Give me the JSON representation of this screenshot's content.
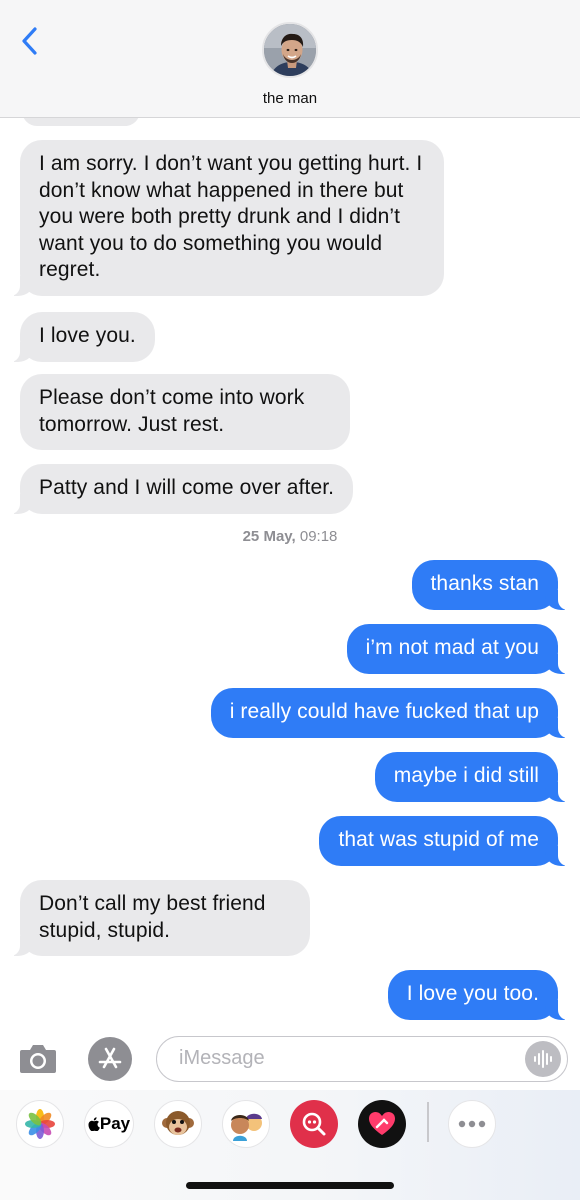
{
  "header": {
    "contact_name": "the man",
    "back_icon": "chevron-left-icon",
    "accent_color": "#2f7cf6"
  },
  "messages": [
    {
      "direction": "incoming",
      "text": "I am sorry. I don’t want you getting hurt. I don’t know what happened in there but you were both pretty drunk and I didn’t want you to do something you would regret."
    },
    {
      "direction": "incoming",
      "text": "I love you."
    },
    {
      "direction": "incoming",
      "text": "Please don’t come into work tomorrow. Just rest."
    },
    {
      "direction": "incoming",
      "text": "Patty and I will come over after."
    },
    {
      "direction": "outgoing",
      "text": "thanks stan"
    },
    {
      "direction": "outgoing",
      "text": "i’m not mad at you"
    },
    {
      "direction": "outgoing",
      "text": "i really could have fucked that up"
    },
    {
      "direction": "outgoing",
      "text": "maybe i did still"
    },
    {
      "direction": "outgoing",
      "text": "that was stupid of me"
    },
    {
      "direction": "incoming",
      "text": "Don’t call my best friend stupid, stupid."
    },
    {
      "direction": "outgoing",
      "text": "I love you too."
    }
  ],
  "timestamp": {
    "date": "25 May,",
    "time": "09:18"
  },
  "input": {
    "placeholder": "iMessage",
    "value": ""
  },
  "app_drawer": {
    "items": [
      {
        "name": "photos-icon"
      },
      {
        "name": "apple-pay-icon",
        "label": "Pay"
      },
      {
        "name": "animoji-icon"
      },
      {
        "name": "memoji-icon"
      },
      {
        "name": "images-search-icon"
      },
      {
        "name": "digital-touch-icon"
      },
      {
        "name": "more-icon"
      }
    ]
  },
  "colors": {
    "incoming_bubble": "#e9e9eb",
    "outgoing_bubble": "#2f7cf6",
    "timestamp": "#8e8e93"
  }
}
